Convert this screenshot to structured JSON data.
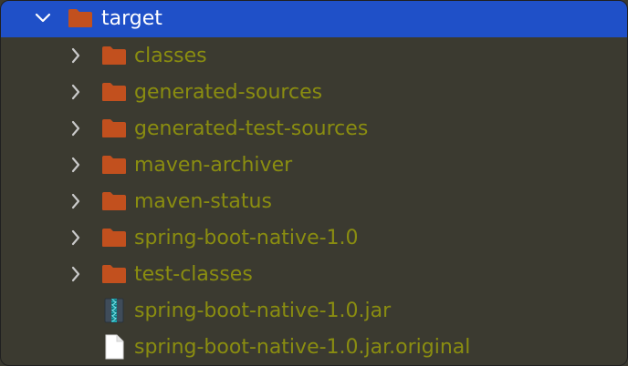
{
  "tree": {
    "root": {
      "label": "target",
      "expanded": true,
      "selected": true,
      "icon": "folder-icon"
    },
    "children": [
      {
        "label": "classes",
        "type": "folder",
        "expanded": false
      },
      {
        "label": "generated-sources",
        "type": "folder",
        "expanded": false
      },
      {
        "label": "generated-test-sources",
        "type": "folder",
        "expanded": false
      },
      {
        "label": "maven-archiver",
        "type": "folder",
        "expanded": false
      },
      {
        "label": "maven-status",
        "type": "folder",
        "expanded": false
      },
      {
        "label": "spring-boot-native-1.0",
        "type": "folder",
        "expanded": false
      },
      {
        "label": "test-classes",
        "type": "folder",
        "expanded": false
      },
      {
        "label": "spring-boot-native-1.0.jar",
        "type": "jar-file"
      },
      {
        "label": "spring-boot-native-1.0.jar.original",
        "type": "file"
      }
    ]
  },
  "colors": {
    "background": "#3b3a30",
    "selection": "#1f50c8",
    "folder": "#c2501e",
    "child_text": "#8a8d10",
    "root_text": "#ffffff"
  }
}
